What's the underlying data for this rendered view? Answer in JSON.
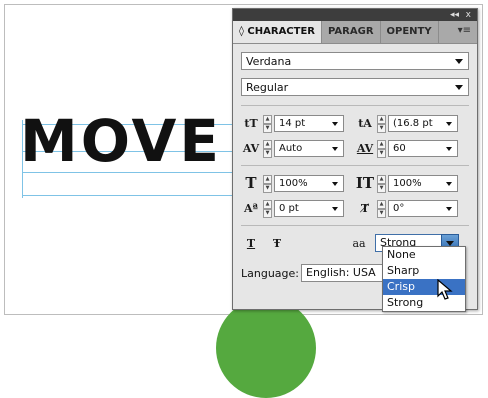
{
  "canvas": {
    "text": "MOVE"
  },
  "panel": {
    "collapse_label": "◂◂",
    "close_label": "x",
    "tabs": [
      {
        "label": "◊ CHARACTER"
      },
      {
        "label": "PARAGR"
      },
      {
        "label": "OPENTY"
      }
    ],
    "menu_label": "▾≡",
    "font_family": "Verdana",
    "font_style": "Regular",
    "font_size": "14 pt",
    "leading": "(16.8 pt",
    "kerning": "Auto",
    "tracking": "60",
    "vertical_scale": "100%",
    "horizontal_scale": "100%",
    "baseline_shift": "0 pt",
    "rotation": "0°",
    "antialias_value": "Strong",
    "language_label": "Language:",
    "language_value": "English: USA"
  },
  "icons": {
    "font_size": "tT",
    "leading": "tA",
    "kerning": "AV",
    "tracking": "AV",
    "vertical_scale": "T",
    "horizontal_scale": "IT",
    "baseline_shift": "Aª",
    "rotation": "T̸",
    "underline": "T",
    "strikethrough": "Ŧ",
    "antialias": "aa"
  },
  "dropdown": {
    "options": [
      "None",
      "Sharp",
      "Crisp",
      "Strong"
    ],
    "highlighted": "Crisp"
  }
}
